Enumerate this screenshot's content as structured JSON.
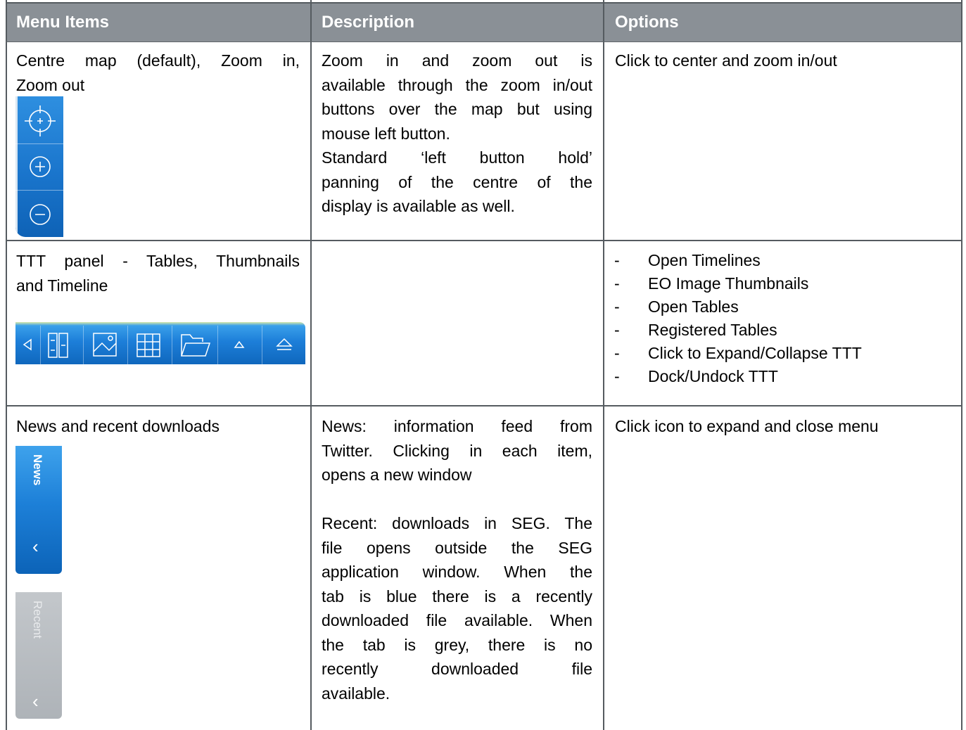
{
  "header": {
    "col1": "Menu Items",
    "col2": "Description",
    "col3": "Options"
  },
  "rows": [
    {
      "menu_item_lines": [
        "Centre map (default), Zoom in,",
        "Zoom out"
      ],
      "description_lines": [
        "Zoom in and zoom out is",
        "available through the zoom in/out",
        "buttons over the map but using",
        "mouse left button.",
        "Standard ‘left button hold’",
        "panning of the centre of the",
        "display is available as well."
      ],
      "option": "Click to center and zoom in/out",
      "icons": [
        "center-map-icon",
        "zoom-in-icon",
        "zoom-out-icon"
      ]
    },
    {
      "menu_item_lines": [
        "TTT panel - Tables, Thumbnails",
        "and Timeline"
      ],
      "description_lines": [],
      "options": [
        "Open Timelines",
        "EO Image Thumbnails",
        "Open Tables",
        "Registered Tables",
        "Click to Expand/Collapse TTT",
        "Dock/Undock TTT"
      ],
      "bullet": "-",
      "icons": [
        "collapse-arrow-icon",
        "timeline-icon",
        "image-thumbnail-icon",
        "table-grid-icon",
        "folder-icon",
        "expand-triangle-icon",
        "eject-dock-icon"
      ]
    },
    {
      "menu_item": "News and recent downloads",
      "news_tab_label": "News",
      "recent_tab_label": "Recent",
      "chevron": "‹",
      "description_lines": [
        "News: information feed from",
        "Twitter. Clicking in each item,",
        "opens a new window",
        "",
        "Recent: downloads in SEG. The",
        "file opens outside the SEG",
        "application window. When the",
        "tab is blue there is a recently",
        "downloaded file available. When",
        "the tab is grey, there is no",
        "recently downloaded file",
        "available."
      ],
      "option": "Click icon to expand and close menu"
    }
  ]
}
